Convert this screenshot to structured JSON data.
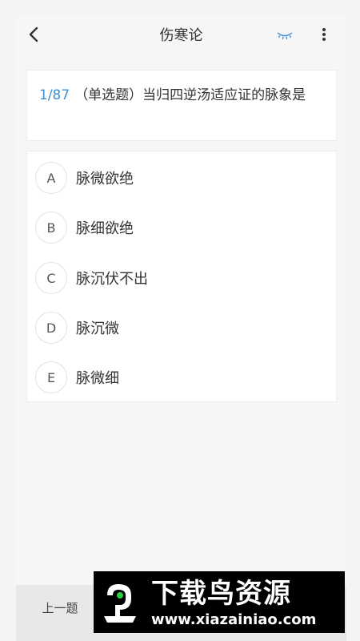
{
  "header": {
    "title": "伤寒论",
    "back_icon": "chevron-left-icon",
    "eye_icon": "eye-closed-icon",
    "more_icon": "more-vertical-icon",
    "accent_color": "#3d8fd6"
  },
  "question": {
    "index": "1/87",
    "text": "（单选题）当归四逆汤适应证的脉象是"
  },
  "options": [
    {
      "letter": "A",
      "text": "脉微欲绝"
    },
    {
      "letter": "B",
      "text": "脉细欲绝"
    },
    {
      "letter": "C",
      "text": "脉沉伏不出"
    },
    {
      "letter": "D",
      "text": "脉沉微"
    },
    {
      "letter": "E",
      "text": "脉微细"
    }
  ],
  "footer": {
    "prev_label": "上一题"
  },
  "watermark": {
    "title": "下载鸟资源",
    "url": "www.xiazainiao.com"
  }
}
